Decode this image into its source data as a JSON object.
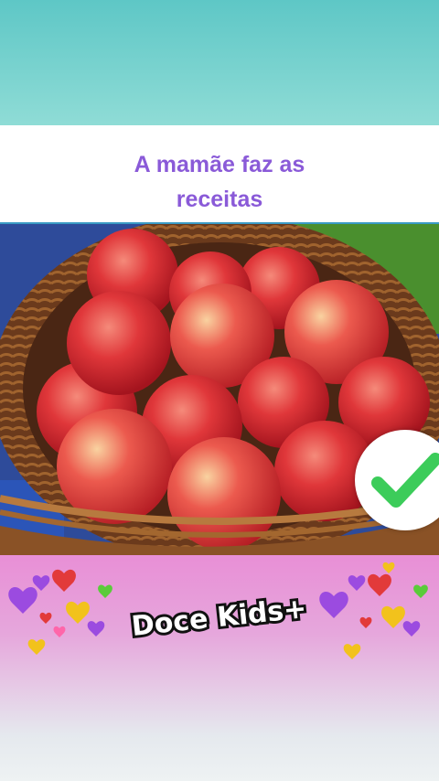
{
  "caption": {
    "line1": "A mamãe faz as",
    "line2": "receitas"
  },
  "image": {
    "subject": "basket-of-red-apples",
    "accent_caption": "#8a5ad8",
    "check_color": "#3ccc5a"
  },
  "badge": {
    "icon": "check-icon"
  },
  "brand": {
    "logo_text": "Doce Kids+"
  },
  "decorations": {
    "icon": "hearts-cluster-icon"
  }
}
